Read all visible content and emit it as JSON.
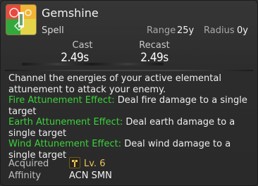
{
  "action": {
    "name": "Gemshine",
    "category": "Spell",
    "icon": "gemshine-icon"
  },
  "stats": {
    "range_label": "Range",
    "range_value": "25y",
    "radius_label": "Radius",
    "radius_value": "0y",
    "cast_label": "Cast",
    "cast_value": "2.49s",
    "recast_label": "Recast",
    "recast_value": "2.49s"
  },
  "description": {
    "intro": "Channel the energies of your active elemental attunement to attack your enemy.",
    "effects": [
      {
        "name": "Fire Attunement Effect:",
        "text": " Deal fire damage to a single target"
      },
      {
        "name": "Earth Attunement Effect:",
        "text": " Deal earth damage to a single target"
      },
      {
        "name": "Wind Attunement Effect:",
        "text": " Deal wind damage to a single target"
      }
    ]
  },
  "footer": {
    "acquired_label": "Acquired",
    "acquired_level": "Lv. 6",
    "acquired_job_icon": "arcanist-icon",
    "affinity_label": "Affinity",
    "affinity_value": "ACN SMN"
  },
  "colors": {
    "effect_name": "#3bd23b",
    "level": "#e6c25a"
  }
}
